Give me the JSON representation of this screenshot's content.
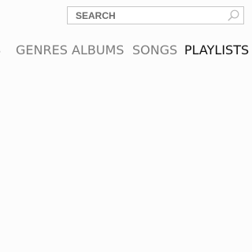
{
  "search": {
    "placeholder": "SEARCH",
    "icon": "search-icon"
  },
  "nav": {
    "items": [
      {
        "label": "S",
        "active": false
      },
      {
        "label": "GENRES",
        "active": false
      },
      {
        "label": "ALBUMS",
        "active": false
      },
      {
        "label": "SONGS",
        "active": false
      },
      {
        "label": "PLAYLISTS",
        "active": true
      }
    ]
  },
  "colors": {
    "background": "#fcfcfc",
    "nav_inactive": "#7c7c7c",
    "nav_active": "#111111"
  }
}
